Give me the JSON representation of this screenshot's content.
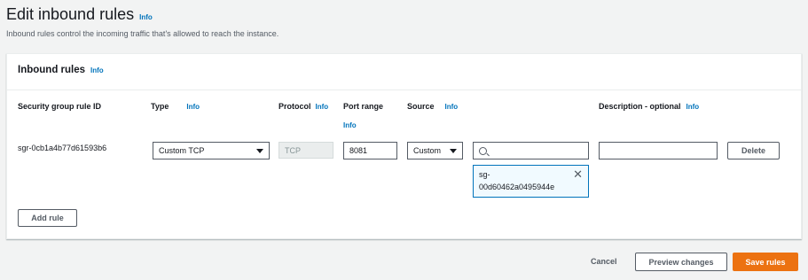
{
  "header": {
    "title": "Edit inbound rules",
    "info": "Info",
    "description": "Inbound rules control the incoming traffic that's allowed to reach the instance."
  },
  "panel": {
    "title": "Inbound rules",
    "info": "Info",
    "columns": {
      "rule_id": "Security group rule ID",
      "type": "Type",
      "protocol": "Protocol",
      "port_range": "Port range",
      "source": "Source",
      "description": "Description - optional",
      "info": "Info"
    },
    "rule": {
      "id": "sgr-0cb1a4b77d61593b6",
      "type": "Custom TCP",
      "protocol": "TCP",
      "port_range": "8081",
      "source_type": "Custom",
      "source_search": "",
      "source_token": "sg-\n00d60462a0495944e",
      "description": "",
      "delete_label": "Delete"
    },
    "add_rule_label": "Add rule"
  },
  "footer": {
    "cancel_label": "Cancel",
    "preview_label": "Preview changes",
    "save_label": "Save rules"
  },
  "colors": {
    "accent": "#ec7211",
    "link": "#0073bb",
    "background": "#f2f3f3"
  }
}
